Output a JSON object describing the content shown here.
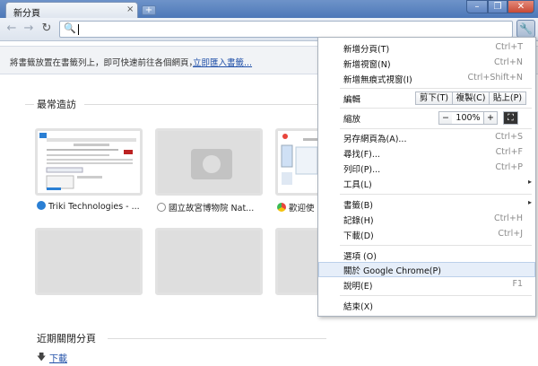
{
  "tab": {
    "title": "新分頁",
    "close_glyph": "×"
  },
  "newtab_glyph": "+",
  "window_buttons": {
    "minimize": "–",
    "maximize": "❐",
    "close": "✕"
  },
  "toolbar": {
    "back": "←",
    "forward": "→",
    "reload": "↻",
    "omni_icon": "🔍",
    "wrench": "🔧"
  },
  "bookmarks_notice": {
    "text": "將書籤放置在書籤列上，即可快速前往各個網頁，",
    "link": "立即匯入書籤..."
  },
  "most_visited": {
    "title": "最常造訪",
    "tiles": [
      {
        "label": "Triki Technologies - ...",
        "favicon_color": "#2a7fd4"
      },
      {
        "label": "國立故宮博物院 Nat...",
        "favicon_color": "#888888"
      },
      {
        "label": "歡迎使",
        "favicon_color": "#e8453c"
      }
    ]
  },
  "recently_closed": {
    "title": "近期關閉分頁",
    "arrow": "🡇",
    "link": "下載"
  },
  "menu": {
    "new_tab": {
      "label": "新增分頁(T)",
      "shortcut": "Ctrl+T"
    },
    "new_window": {
      "label": "新增視窗(N)",
      "shortcut": "Ctrl+N"
    },
    "incognito": {
      "label": "新增無痕式視窗(I)",
      "shortcut": "Ctrl+Shift+N"
    },
    "edit": {
      "label": "編輯",
      "cut": "剪下(T)",
      "copy": "複製(C)",
      "paste": "貼上(P)"
    },
    "zoom": {
      "label": "縮放",
      "minus": "−",
      "value": "100%",
      "plus": "+",
      "fullscreen": "⛶"
    },
    "save_as": {
      "label": "另存網頁為(A)...",
      "shortcut": "Ctrl+S"
    },
    "find": {
      "label": "尋找(F)...",
      "shortcut": "Ctrl+F"
    },
    "print": {
      "label": "列印(P)...",
      "shortcut": "Ctrl+P"
    },
    "tools": {
      "label": "工具(L)",
      "arrow": "▸"
    },
    "bookmarks": {
      "label": "書籤(B)",
      "arrow": "▸"
    },
    "history": {
      "label": "記錄(H)",
      "shortcut": "Ctrl+H"
    },
    "downloads": {
      "label": "下載(D)",
      "shortcut": "Ctrl+J"
    },
    "options": {
      "label": "選項 (O)"
    },
    "about": {
      "label": "關於 Google Chrome(P)"
    },
    "help": {
      "label": "說明(E)",
      "shortcut": "F1"
    },
    "exit": {
      "label": "結束(X)"
    }
  }
}
